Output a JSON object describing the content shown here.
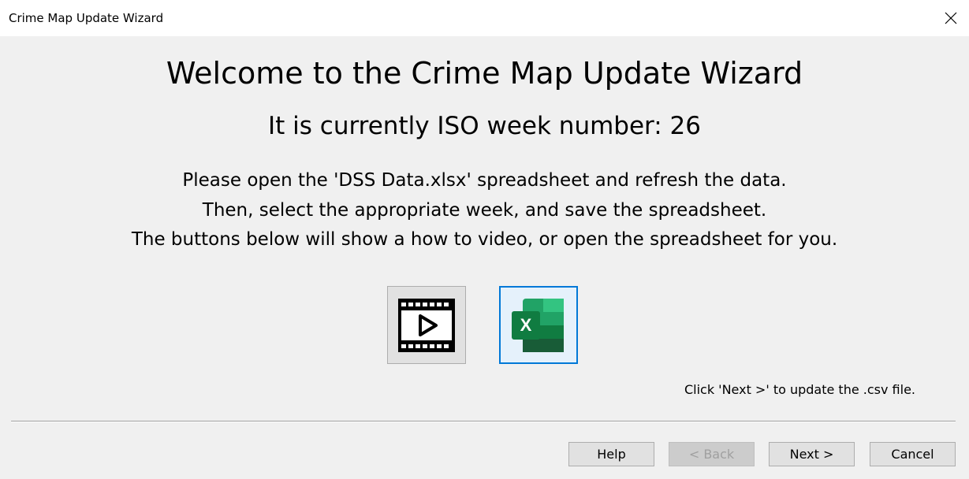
{
  "window": {
    "title": "Crime Map Update Wizard",
    "close_icon": "close-icon"
  },
  "main": {
    "welcome": "Welcome to the Crime Map Update Wizard",
    "week_line": "It is currently ISO week number: 26",
    "instructions": [
      "Please open the 'DSS Data.xlsx' spreadsheet and refresh the data.",
      "Then, select the appropriate week, and save the spreadsheet.",
      "The buttons below will show a how to video, or open the spreadsheet for you."
    ],
    "video_button_icon": "video-play-icon",
    "excel_button_icon": "excel-icon",
    "excel_icon_letter": "X",
    "hint": "Click 'Next >' to update the .csv file."
  },
  "footer": {
    "help": "Help",
    "back": "< Back",
    "next": "Next >",
    "cancel": "Cancel"
  },
  "colors": {
    "focus_border": "#0078d7",
    "excel_green": "#107c41"
  }
}
